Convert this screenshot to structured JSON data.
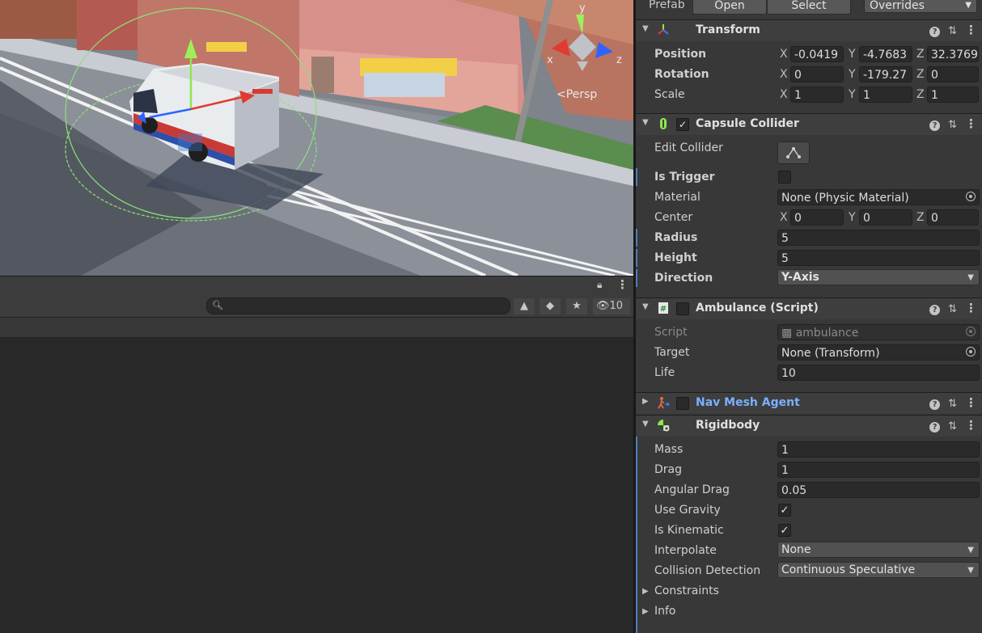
{
  "scene": {
    "persp_label": "Persp",
    "gizmo_axes": {
      "y": "y",
      "x": "x",
      "z": "z"
    }
  },
  "hierarchy_toolbar": {
    "hidden_count": "10"
  },
  "inspector": {
    "prefab": {
      "label": "Prefab",
      "open": "Open",
      "select": "Select",
      "overrides": "Overrides"
    },
    "transform": {
      "title": "Transform",
      "position": {
        "label": "Position",
        "x": "-0.0419",
        "y": "-4.7683",
        "z": "32.3769"
      },
      "rotation": {
        "label": "Rotation",
        "x": "0",
        "y": "-179.27",
        "z": "0"
      },
      "scale": {
        "label": "Scale",
        "x": "1",
        "y": "1",
        "z": "1"
      }
    },
    "capsule": {
      "title": "Capsule Collider",
      "edit_collider": "Edit Collider",
      "is_trigger": "Is Trigger",
      "material": {
        "label": "Material",
        "value": "None (Physic Material)"
      },
      "center": {
        "label": "Center",
        "x": "0",
        "y": "0",
        "z": "0"
      },
      "radius": {
        "label": "Radius",
        "value": "5"
      },
      "height": {
        "label": "Height",
        "value": "5"
      },
      "direction": {
        "label": "Direction",
        "value": "Y-Axis"
      }
    },
    "script": {
      "title": "Ambulance (Script)",
      "script": {
        "label": "Script",
        "value": "ambulance"
      },
      "target": {
        "label": "Target",
        "value": "None (Transform)"
      },
      "life": {
        "label": "Life",
        "value": "10"
      }
    },
    "navmesh": {
      "title": "Nav Mesh Agent"
    },
    "rigidbody": {
      "title": "Rigidbody",
      "mass": {
        "label": "Mass",
        "value": "1"
      },
      "drag": {
        "label": "Drag",
        "value": "1"
      },
      "angular_drag": {
        "label": "Angular Drag",
        "value": "0.05"
      },
      "use_gravity": {
        "label": "Use Gravity",
        "checked": true
      },
      "is_kinematic": {
        "label": "Is Kinematic",
        "checked": true
      },
      "interpolate": {
        "label": "Interpolate",
        "value": "None"
      },
      "collision_detection": {
        "label": "Collision Detection",
        "value": "Continuous Speculative"
      },
      "constraints": "Constraints",
      "info": "Info"
    }
  },
  "axis_labels": {
    "x": "X",
    "y": "Y",
    "z": "Z"
  },
  "colors": {
    "accent_blue": "#4c7fbd",
    "navmesh_title": "#7ab0ff"
  }
}
